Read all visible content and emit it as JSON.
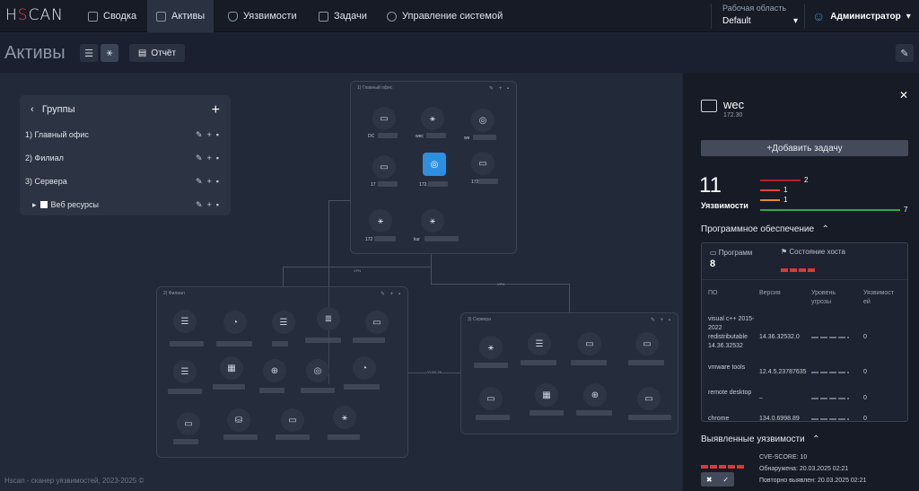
{
  "nav": {
    "logo": "HSCAN",
    "items": [
      "Сводка",
      "Активы",
      "Уязвимости",
      "Задачи",
      "Управление системой"
    ],
    "workspace_label": "Рабочая область",
    "workspace_value": "Default",
    "user": "Администратор"
  },
  "page": {
    "title": "Активы",
    "report": "Отчёт"
  },
  "groups": {
    "title": "Группы",
    "items": [
      "1) Главный офис",
      "2) Филиал",
      "3) Сервера",
      "Веб ресурсы"
    ]
  },
  "boxes": {
    "main": "1) Главный офис",
    "branch": "2) Филиал",
    "servers": "3) Сервера"
  },
  "nodes": {
    "dc": "DC",
    "wec": "wec",
    "we": "we",
    "ip1": "17",
    "ip2": "172.",
    "ip3": "172",
    "kur": "kur",
    "ip4": "172"
  },
  "links": {
    "vpn1": "VPN",
    "vpn2": "VPN",
    "vlan": "VLAN 86"
  },
  "footer": "Hscan - сканер уязвимостей, 2023-2025 ©",
  "panel": {
    "title": "wec",
    "ip": "172.30",
    "add_task": "Добавить задачу",
    "vuln_count": "11",
    "vuln_label": "Уязвимости",
    "bars": [
      {
        "value": "2",
        "color": "#b81f24",
        "fill": 0.29
      },
      {
        "value": "1",
        "color": "#e0483a",
        "fill": 0.14
      },
      {
        "value": "1",
        "color": "#e38a2a",
        "fill": 0.14
      },
      {
        "value": "7",
        "color": "#2fa84a",
        "fill": 1.0
      }
    ],
    "software_title": "Программное обеспечение",
    "software_label": "Программ",
    "software_count": "8",
    "host_state": "Состояние хоста",
    "cols": [
      "ПО",
      "Версия",
      "Уровень угрозы",
      "Уязвимост ей"
    ],
    "rows": [
      {
        "name": "visual c++ 2015-2022 redistributable 14.36.32532",
        "ver": "14.36.32532.0",
        "vul": "0"
      },
      {
        "name": "vmware tools",
        "ver": "12.4.5.23787635",
        "vul": "0"
      },
      {
        "name": "remote desktop",
        "ver": "–",
        "vul": "0"
      },
      {
        "name": "chrome",
        "ver": "134.0.6998.89",
        "vul": "0"
      }
    ],
    "found_title": "Выявленные уязвимости",
    "cve": "CVE-SCORE: 10",
    "detected": "Обнаружена: 20.03.2025 02:21",
    "redetected": "Повторно выявлен: 20.03.2025 02:21"
  },
  "colors": {
    "accent": "#2e8fe0",
    "danger": "#d83a3a"
  }
}
